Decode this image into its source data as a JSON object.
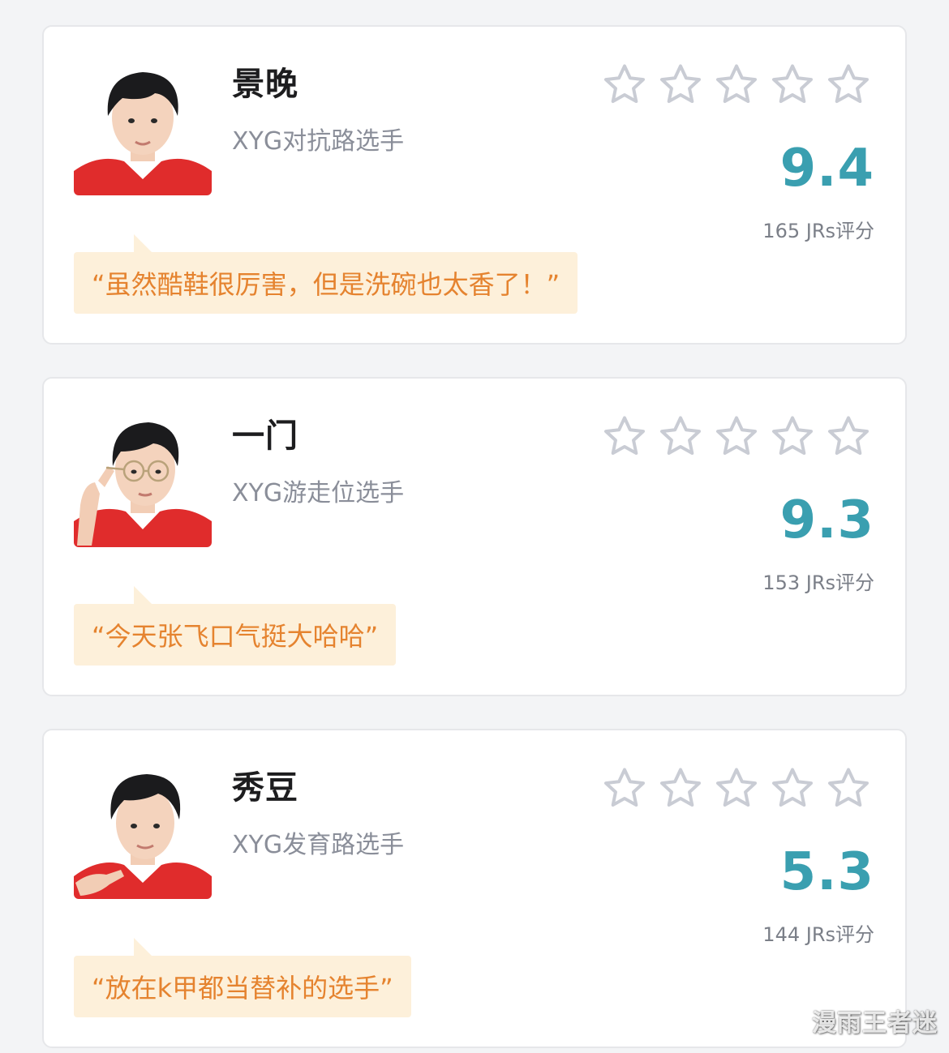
{
  "colors": {
    "accent_score": "#3a9fb0",
    "quote_text": "#e5832f",
    "quote_bg": "#fdf0da",
    "star_outline": "#c9ccd4"
  },
  "players": [
    {
      "avatar_icon": "player-photo-icon",
      "name": "景晚",
      "role": "XYG对抗路选手",
      "stars_filled": 0,
      "stars_total": 5,
      "score": "9.4",
      "raters": "165 JRs评分",
      "quote": "“虽然酷鞋很厉害，但是洗碗也太香了！”"
    },
    {
      "avatar_icon": "player-photo-icon",
      "name": "一门",
      "role": "XYG游走位选手",
      "stars_filled": 0,
      "stars_total": 5,
      "score": "9.3",
      "raters": "153 JRs评分",
      "quote": "“今天张飞口气挺大哈哈”"
    },
    {
      "avatar_icon": "player-photo-icon",
      "name": "秀豆",
      "role": "XYG发育路选手",
      "stars_filled": 0,
      "stars_total": 5,
      "score": "5.3",
      "raters": "144 JRs评分",
      "quote": "“放在k甲都当替补的选手”"
    }
  ],
  "watermark": "漫雨王者迷"
}
